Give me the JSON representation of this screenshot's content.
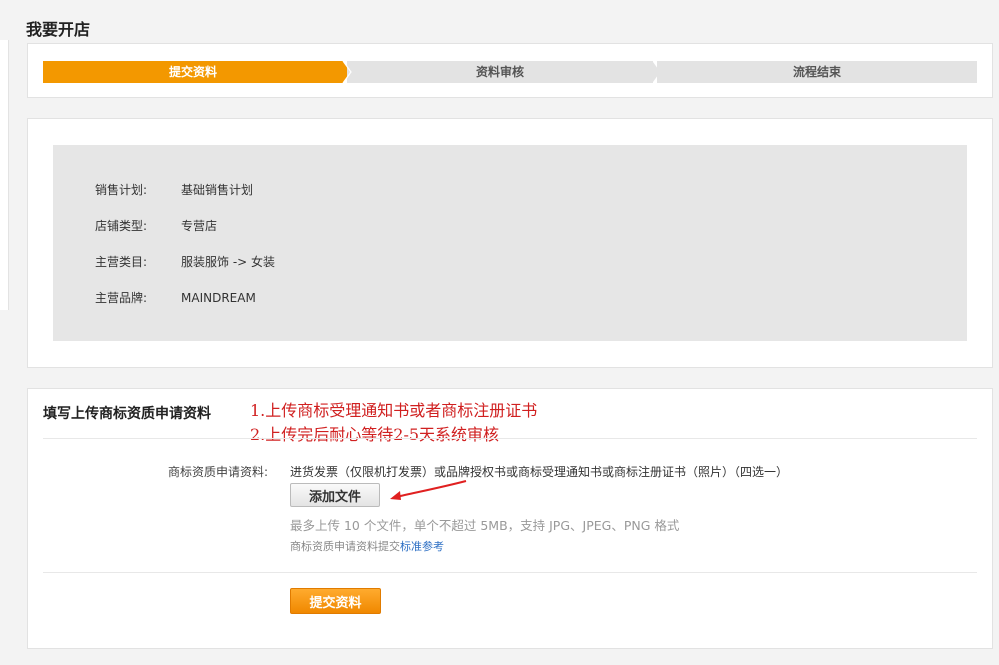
{
  "page": {
    "title": "我要开店"
  },
  "steps": [
    {
      "label": "提交资料",
      "active": true
    },
    {
      "label": "资料审核",
      "active": false
    },
    {
      "label": "流程结束",
      "active": false
    }
  ],
  "info": [
    {
      "label": "销售计划:",
      "value": "基础销售计划"
    },
    {
      "label": "店铺类型:",
      "value": "专营店"
    },
    {
      "label": "主营类目:",
      "value": "服装服饰 -> 女装"
    },
    {
      "label": "主营品牌:",
      "value": "MAINDREAM"
    }
  ],
  "upload": {
    "section_title": "填写上传商标资质申请资料",
    "annotation_line1": "1.上传商标受理通知书或者商标注册证书",
    "annotation_line2": "2.上传完后耐心等待2-5天系统审核",
    "field_label": "商标资质申请资料:",
    "field_desc": "进货发票（仅限机打发票）或品牌授权书或商标受理通知书或商标注册证书（照片）（四选一）",
    "add_file_label": "添加文件",
    "hint": "最多上传 10 个文件，单个不超过 5MB，支持 JPG、JPEG、PNG 格式",
    "sub_hint_prefix": "商标资质申请资料提交",
    "sub_hint_link": "标准参考",
    "submit_label": "提交资料"
  },
  "colors": {
    "accent": "#f39800",
    "annotation": "#d02020",
    "link": "#2d6fc4"
  }
}
